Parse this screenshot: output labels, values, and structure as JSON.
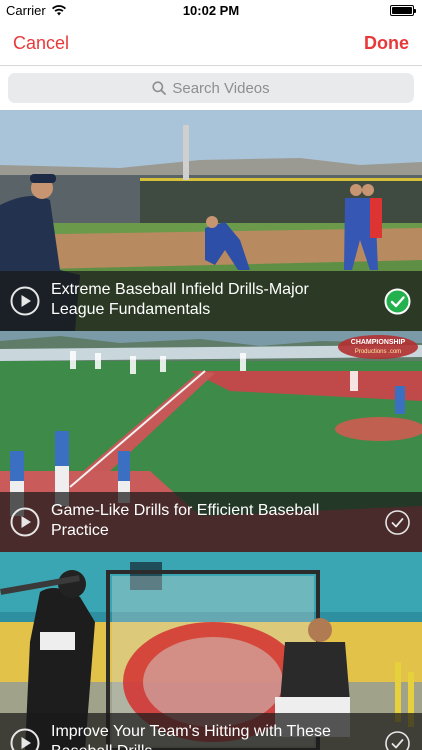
{
  "status_bar": {
    "carrier": "Carrier",
    "time": "10:02 PM"
  },
  "nav": {
    "cancel_label": "Cancel",
    "done_label": "Done",
    "accent_color": "#e8393a"
  },
  "search": {
    "placeholder": "Search Videos"
  },
  "videos": [
    {
      "title": "Extreme Baseball Infield Drills-Major League Fundamentals",
      "selected": true
    },
    {
      "title": "Game-Like Drills for Efficient Baseball Practice",
      "selected": false
    },
    {
      "title": "Improve Your Team's Hitting with These Baseball Drills",
      "selected": false
    }
  ],
  "icons": {
    "play": "play-circle-icon",
    "check_selected": "checkmark-circle-filled-icon",
    "check_unselected": "checkmark-circle-outline-icon",
    "search": "search-icon",
    "wifi": "wifi-icon",
    "battery": "battery-icon"
  },
  "thumbnail_watermark": "CHAMPIONSHIP Productions .com"
}
